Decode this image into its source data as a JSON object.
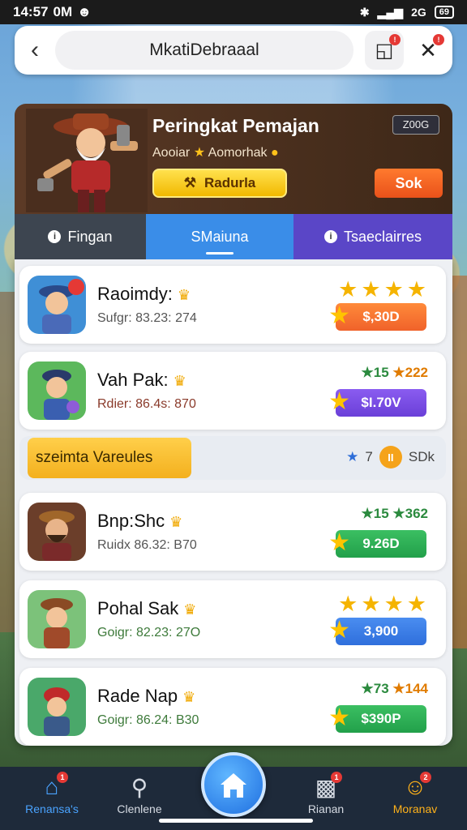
{
  "status_bar": {
    "time": "14:57",
    "carrier": "0M",
    "right_text": "2G",
    "battery": "69"
  },
  "top_bar": {
    "title": "MkatiDebraaal"
  },
  "hero": {
    "title": "Peringkat Pemajan",
    "badge": "Z00G",
    "subtitle_left": "Aooiar",
    "subtitle_right": "Aomorhak",
    "primary_button": "Radurla",
    "secondary_button": "Sok"
  },
  "tabs": [
    {
      "label": "Fingan",
      "icon": "info-icon"
    },
    {
      "label": "SMaiuna",
      "active": true
    },
    {
      "label": "Tsaeclairres",
      "icon": "info-icon"
    }
  ],
  "list": [
    {
      "name": "Raoimdy:",
      "meta": "Sufgr: 83.23: 274",
      "rating_type": "stars",
      "stars": 4,
      "price": "$,30D",
      "price_color": "orange",
      "accent": "#f0622a"
    },
    {
      "name": "Vah Pak:",
      "meta": "Rdier: 86.4s: 870",
      "rating_type": "stats",
      "stat_a": "★15",
      "stat_b": "★222",
      "price": "$I.70V",
      "price_color": "purple",
      "accent": "#6a3fd8"
    },
    {
      "name": "Bnp:Shc",
      "meta": "Ruidx 86.32: B70",
      "rating_type": "stats",
      "stat_a": "★15",
      "stat_b": "★362",
      "price": "9.26D",
      "price_color": "green",
      "accent": "#22a04a"
    },
    {
      "name": "Pohal Sak",
      "meta": "Goigr: 82.23: 27O",
      "rating_type": "stars",
      "stars": 4,
      "price": "3,900",
      "price_color": "blue",
      "accent": "#2f6fdc"
    },
    {
      "name": "Rade Nap",
      "meta": "Goigr: 86.24: B30",
      "rating_type": "stats",
      "stat_a": "★73",
      "stat_b": "★144",
      "price": "$390P",
      "price_color": "green",
      "accent": "#22a04a"
    }
  ],
  "banner": {
    "label": "szeimta Vareules",
    "right_count": "7",
    "right_text": "SDk"
  },
  "bottom_nav": [
    {
      "label": "Renansa's",
      "icon": "home-icon",
      "badge": "1",
      "state": "active"
    },
    {
      "label": "Clenlene",
      "icon": "search-icon",
      "badge": ""
    },
    {
      "label": "",
      "icon": "house-icon",
      "badge": "",
      "state": "center"
    },
    {
      "label": "Rianan",
      "icon": "chat-icon",
      "badge": "1"
    },
    {
      "label": "Moranav",
      "icon": "profile-icon",
      "badge": "2",
      "state": "gold"
    }
  ]
}
